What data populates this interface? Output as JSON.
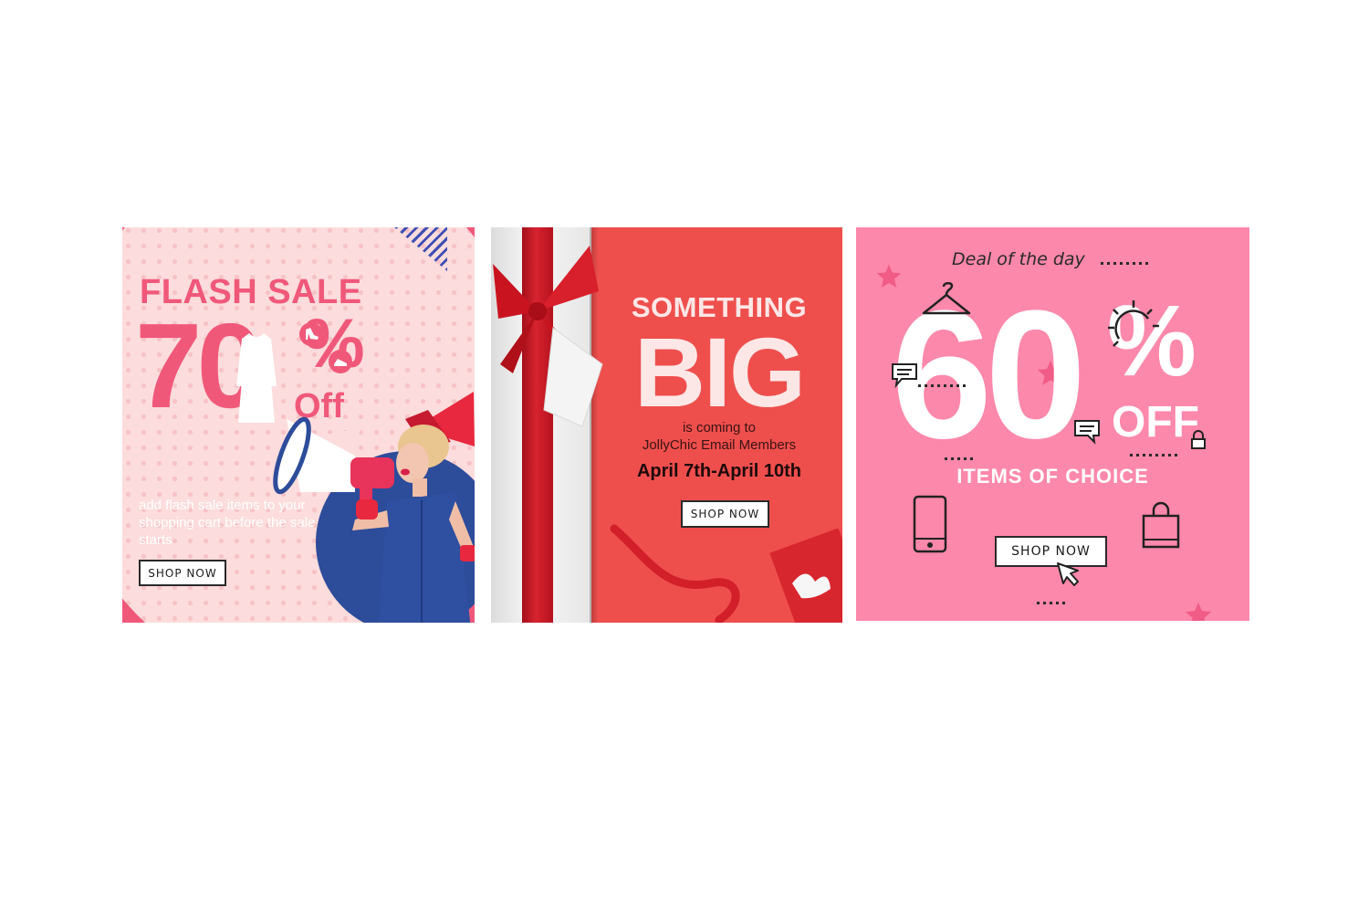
{
  "colors": {
    "b1_pink": "#f0587a",
    "b1_bubble": "#fcdcdc",
    "b1_blue": "#2d4c9a",
    "b2_red": "#ee4f4d",
    "b2_ribbon": "#d7232f",
    "b3_pink": "#fc88ab",
    "white": "#ffffff"
  },
  "banner1": {
    "title": "FLASH SALE",
    "number": "70",
    "percent": "%",
    "off": "Off",
    "description": "add flash sale items to your shopping cart before the sale starts",
    "button": "SHOP NOW",
    "icons": [
      "dress-icon",
      "heel-icon",
      "shoe-icon",
      "megaphone-icon"
    ]
  },
  "banner2": {
    "title": "SOMETHING",
    "big_word": "BIG",
    "line1": "is coming to",
    "line2": "JollyChic Email Members",
    "dates": "April 7th-April 10th",
    "button": "SHOP NOW",
    "icons": [
      "ribbon-bow-icon",
      "gift-box-icon"
    ]
  },
  "banner3": {
    "deal": "Deal of the day",
    "number": "60",
    "percent": "%",
    "off": "OFF",
    "subtitle": "ITEMS OF CHOICE",
    "button": "SHOP NOW",
    "icons": [
      "hanger-icon",
      "sun-icon",
      "chat-icon",
      "lock-icon",
      "phone-icon",
      "shopping-bag-icon",
      "cursor-icon",
      "star-icon"
    ]
  }
}
